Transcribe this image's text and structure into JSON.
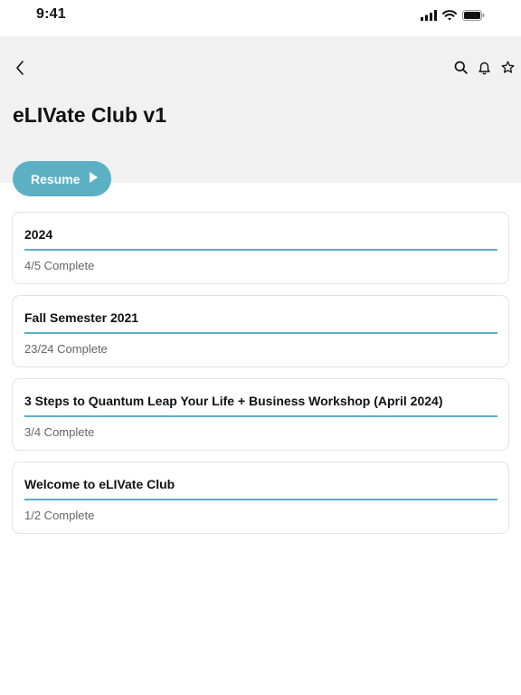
{
  "status_bar": {
    "time": "9:41",
    "icons": [
      "signal-icon",
      "wifi-icon",
      "battery-icon"
    ]
  },
  "header": {
    "back_icon": "chevron-left-icon",
    "actions": [
      "search-icon",
      "bell-icon",
      "star-icon"
    ],
    "title": "eLIVate Club v1"
  },
  "resume": {
    "label": "Resume",
    "icon": "play-icon"
  },
  "colors": {
    "accent": "#5bb0c4",
    "header_bg": "#f1f1f1"
  },
  "courses": [
    {
      "title": "2024",
      "status": "4/5 Complete",
      "progress": 1.0
    },
    {
      "title": "Fall Semester 2021",
      "status": "23/24 Complete",
      "progress": 1.0
    },
    {
      "title": "3 Steps to Quantum Leap Your Life + Business Workshop (April 2024)",
      "status": "3/4 Complete",
      "progress": 1.0
    },
    {
      "title": "Welcome to eLIVate Club",
      "status": "1/2 Complete",
      "progress": 1.0
    }
  ]
}
